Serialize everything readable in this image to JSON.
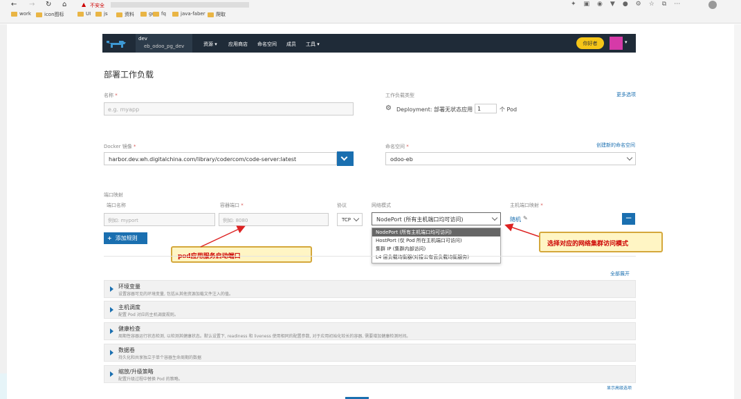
{
  "browser": {
    "insecure_label": "不安全",
    "url": "http://...",
    "bookmarks": [
      "work",
      "icon图标",
      "UI",
      "js",
      "资料",
      "go",
      "fq",
      "java-faber",
      "爬取"
    ]
  },
  "nav": {
    "env": "dev",
    "project": "eb_odoo_pg_dev",
    "menu": [
      "资源",
      "应用商店",
      "命名空间",
      "成员",
      "工具"
    ],
    "user_button": "你好者"
  },
  "page": {
    "title": "部署工作负载"
  },
  "form": {
    "name_label": "名称",
    "name_placeholder": "e.g. myapp",
    "workload_type_label": "工作负载类型",
    "more_options": "更多选项",
    "workload_desc": "Deployment: 部署无状态应用",
    "replicas": "1",
    "pod_unit": "个 Pod",
    "image_label": "Docker 镜像",
    "image_value": "harbor.dev.wh.digitalchina.com/library/codercom/code-server:latest",
    "namespace_label": "命名空间",
    "namespace_link": "创建新的命名空间",
    "namespace_value": "odoo-eb",
    "port_mapping_label": "端口映射",
    "col_port_name": "端口名称",
    "col_container_port": "容器端口",
    "col_protocol": "协议",
    "col_network_mode": "网络模式",
    "col_host_port": "主机端口映射",
    "port_name_placeholder": "例如: myport",
    "container_port_placeholder": "例如: 8080",
    "protocol_value": "TCP",
    "network_mode_value": "NodePort (所有主机端口均可访问)",
    "host_port_value": "随机",
    "add_rule": "添加规则",
    "dropdown_options": [
      "NodePort (所有主机端口均可访问)",
      "HostPort (仅 Pod 所在主机端口可访问)",
      "集群 IP (集群内部访问)",
      "L4 层负载均衡器(对接公有云负载均衡服务)"
    ],
    "expand_all": "全部展开",
    "show_advanced": "显示高级选项"
  },
  "sections": [
    {
      "title": "环境变量",
      "desc": "设置容器可见的环境变量, 包括从其他资源加载文件注入的值。"
    },
    {
      "title": "主机调度",
      "desc": "配置 Pod 对应的主机调度规则。"
    },
    {
      "title": "健康检查",
      "desc": "周期性容器运行状态检测, 以检测其健康状态。默认设置下, readiness 和 liveness 使用相同的配置参数, 对于应用初始化较长的容器, 需要增加健康检测时间。"
    },
    {
      "title": "数据卷",
      "desc": "持久化和共享独立于单个容器生命周期的数据"
    },
    {
      "title": "缩放/升级策略",
      "desc": "配置升级过程中替换 Pod 的策略。"
    }
  ],
  "callouts": {
    "left": "pod应用服务启动端口",
    "right": "选择对应的网络集群访问模式"
  },
  "colors": {
    "navbar": "#1f2b38",
    "primary": "#1a6fb0",
    "callout_bg": "#fff5c4",
    "callout_text": "#cc0000"
  }
}
